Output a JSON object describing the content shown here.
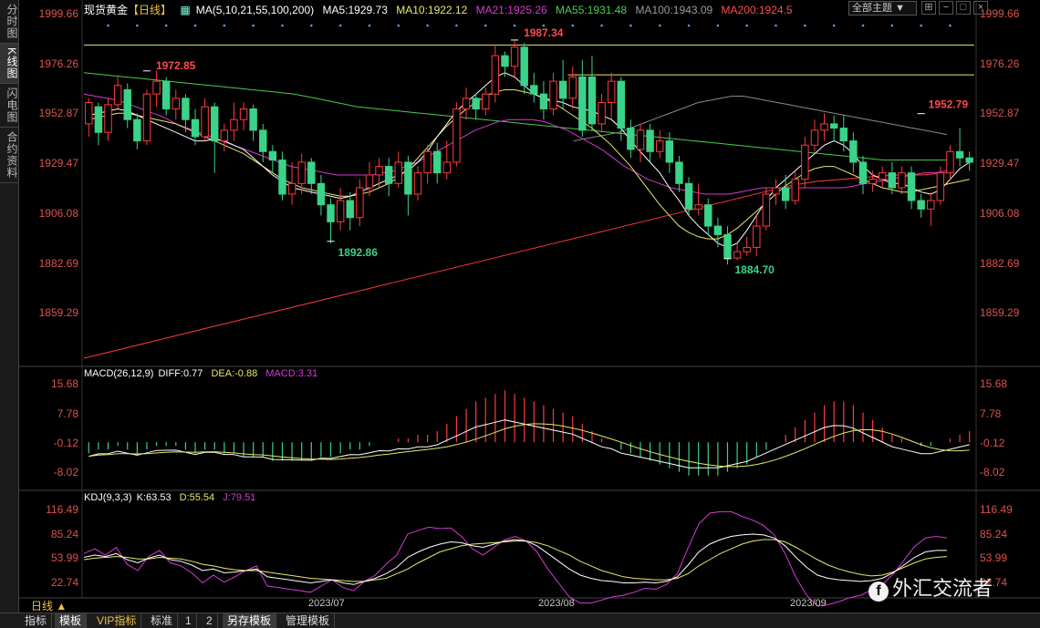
{
  "sidebar": {
    "items": [
      {
        "label": "分时图"
      },
      {
        "label": "K线图"
      },
      {
        "label": "闪电图"
      },
      {
        "label": "合约资料"
      }
    ]
  },
  "header": {
    "symbol": "现货黄金",
    "period": "【日线】",
    "ma_label": "MA(5,10,21,55,100,200)",
    "ma5": "MA5:1929.73",
    "ma10": "MA10:1922.12",
    "ma21": "MA21:1925.26",
    "ma55": "MA55:1931.48",
    "ma100": "MA100:1943.09",
    "ma200": "MA200:1924.5",
    "theme": "全部主题",
    "theme_arrow": "▼"
  },
  "colors": {
    "up": "#ff3b3b",
    "down": "#3ad389",
    "ma5": "#ffffff",
    "ma10": "#e8e86a",
    "ma21": "#d43bd4",
    "ma55": "#4ccb4c",
    "ma100": "#8a8a8a",
    "ma200": "#ff3b3b",
    "ref": "#e8e86a"
  },
  "price_axis": {
    "ticks": [
      "1999.66",
      "1976.26",
      "1952.87",
      "1929.47",
      "1906.08",
      "1882.69",
      "1859.29"
    ],
    "ymin": 1835,
    "ymax": 2001
  },
  "annotations": [
    {
      "text": "1972.85",
      "color": "#ff4b4b"
    },
    {
      "text": "1987.34",
      "color": "#ff4b4b"
    },
    {
      "text": "1892.86",
      "color": "#3ad389"
    },
    {
      "text": "1952.79",
      "color": "#ff4b4b"
    },
    {
      "text": "1884.70",
      "color": "#3ad389"
    }
  ],
  "macd": {
    "label": "MACD(26,12,9)",
    "diff": "DIFF:0.77",
    "dea": "DEA:-0.88",
    "macd": "MACD:3.31",
    "ticks": [
      "15.68",
      "7.78",
      "-0.12",
      "-8.02"
    ]
  },
  "kdj": {
    "label": "KDJ(9,3,3)",
    "k": "K:63.53",
    "d": "D:55.54",
    "j": "J:79.51",
    "ticks": [
      "116.49",
      "85.24",
      "53.99",
      "22.74"
    ]
  },
  "date_axis": {
    "labels": [
      "2023/07",
      "2023/08",
      "2023/09"
    ]
  },
  "period_label": "日线",
  "bottom_tabs": [
    "指标",
    "模板",
    "VIP指标",
    "标准",
    "1",
    "2",
    "另存模板",
    "管理模板"
  ],
  "watermark": {
    "logo": "f",
    "text": "外汇交流者"
  },
  "chart_data": {
    "type": "candlestick",
    "candles": [
      [
        1948,
        1958,
        1942,
        1960
      ],
      [
        1956,
        1944,
        1938,
        1958
      ],
      [
        1944,
        1957,
        1940,
        1960
      ],
      [
        1957,
        1966,
        1955,
        1970
      ],
      [
        1964,
        1950,
        1946,
        1967
      ],
      [
        1950,
        1940,
        1936,
        1953
      ],
      [
        1940,
        1962,
        1938,
        1964
      ],
      [
        1962,
        1968,
        1956,
        1973
      ],
      [
        1968,
        1955,
        1952,
        1970
      ],
      [
        1955,
        1960,
        1950,
        1964
      ],
      [
        1960,
        1950,
        1944,
        1962
      ],
      [
        1950,
        1942,
        1938,
        1955
      ],
      [
        1942,
        1956,
        1940,
        1960
      ],
      [
        1956,
        1940,
        1925,
        1958
      ],
      [
        1940,
        1945,
        1935,
        1948
      ],
      [
        1945,
        1950,
        1940,
        1958
      ],
      [
        1950,
        1955,
        1945,
        1958
      ],
      [
        1955,
        1945,
        1940,
        1957
      ],
      [
        1945,
        1935,
        1930,
        1948
      ],
      [
        1935,
        1931,
        1925,
        1938
      ],
      [
        1931,
        1915,
        1912,
        1935
      ],
      [
        1915,
        1920,
        1910,
        1930
      ],
      [
        1920,
        1930,
        1915,
        1934
      ],
      [
        1930,
        1920,
        1915,
        1932
      ],
      [
        1920,
        1910,
        1905,
        1924
      ],
      [
        1910,
        1902,
        1892,
        1913
      ],
      [
        1902,
        1912,
        1898,
        1918
      ],
      [
        1912,
        1904,
        1898,
        1916
      ],
      [
        1904,
        1918,
        1900,
        1922
      ],
      [
        1918,
        1924,
        1914,
        1930
      ],
      [
        1924,
        1928,
        1918,
        1932
      ],
      [
        1928,
        1920,
        1914,
        1932
      ],
      [
        1920,
        1930,
        1918,
        1935
      ],
      [
        1930,
        1915,
        1905,
        1933
      ],
      [
        1915,
        1925,
        1912,
        1928
      ],
      [
        1925,
        1935,
        1920,
        1938
      ],
      [
        1935,
        1925,
        1920,
        1939
      ],
      [
        1925,
        1930,
        1922,
        1940
      ],
      [
        1930,
        1955,
        1928,
        1958
      ],
      [
        1955,
        1960,
        1950,
        1965
      ],
      [
        1960,
        1955,
        1950,
        1962
      ],
      [
        1955,
        1962,
        1952,
        1965
      ],
      [
        1962,
        1980,
        1958,
        1985
      ],
      [
        1980,
        1975,
        1970,
        1982
      ],
      [
        1975,
        1984,
        1970,
        1987
      ],
      [
        1984,
        1966,
        1962,
        1986
      ],
      [
        1966,
        1962,
        1958,
        1972
      ],
      [
        1962,
        1955,
        1950,
        1968
      ],
      [
        1955,
        1968,
        1952,
        1972
      ],
      [
        1968,
        1960,
        1955,
        1978
      ],
      [
        1960,
        1970,
        1955,
        1975
      ],
      [
        1970,
        1945,
        1942,
        1978
      ],
      [
        1970,
        1948,
        1945,
        1980
      ],
      [
        1948,
        1958,
        1944,
        1962
      ],
      [
        1958,
        1968,
        1950,
        1972
      ],
      [
        1968,
        1946,
        1940,
        1970
      ],
      [
        1946,
        1936,
        1932,
        1950
      ],
      [
        1936,
        1945,
        1930,
        1948
      ],
      [
        1945,
        1935,
        1930,
        1948
      ],
      [
        1935,
        1940,
        1932,
        1945
      ],
      [
        1940,
        1930,
        1925,
        1944
      ],
      [
        1930,
        1920,
        1916,
        1933
      ],
      [
        1920,
        1908,
        1905,
        1923
      ],
      [
        1908,
        1910,
        1905,
        1920
      ],
      [
        1910,
        1900,
        1896,
        1913
      ],
      [
        1900,
        1896,
        1890,
        1904
      ],
      [
        1896,
        1885,
        1882,
        1900
      ],
      [
        1885,
        1888,
        1884,
        1892
      ],
      [
        1888,
        1890,
        1886,
        1895
      ],
      [
        1890,
        1900,
        1886,
        1905
      ],
      [
        1900,
        1915,
        1898,
        1918
      ],
      [
        1915,
        1918,
        1910,
        1922
      ],
      [
        1918,
        1912,
        1908,
        1924
      ],
      [
        1912,
        1922,
        1910,
        1926
      ],
      [
        1922,
        1938,
        1918,
        1942
      ],
      [
        1938,
        1945,
        1935,
        1950
      ],
      [
        1945,
        1948,
        1940,
        1953
      ],
      [
        1948,
        1946,
        1940,
        1952
      ],
      [
        1946,
        1940,
        1935,
        1952
      ],
      [
        1940,
        1930,
        1925,
        1944
      ],
      [
        1930,
        1920,
        1915,
        1933
      ],
      [
        1920,
        1922,
        1916,
        1926
      ],
      [
        1922,
        1925,
        1918,
        1928
      ],
      [
        1925,
        1918,
        1915,
        1930
      ],
      [
        1918,
        1925,
        1915,
        1928
      ],
      [
        1925,
        1912,
        1908,
        1928
      ],
      [
        1912,
        1908,
        1904,
        1915
      ],
      [
        1908,
        1912,
        1900,
        1916
      ],
      [
        1912,
        1925,
        1910,
        1928
      ],
      [
        1925,
        1935,
        1922,
        1938
      ],
      [
        1935,
        1932,
        1928,
        1946
      ],
      [
        1932,
        1930,
        1926,
        1935
      ]
    ],
    "ma_lines": {
      "ma5": [
        1952,
        1953,
        1954,
        1955,
        1954,
        1952,
        1950,
        1948,
        1946,
        1944,
        1942,
        1940,
        1940,
        1941,
        1940,
        1938,
        1936,
        1932,
        1928,
        1924,
        1921,
        1918,
        1917,
        1916,
        1915,
        1914,
        1913,
        1914,
        1916,
        1918,
        1920,
        1922,
        1924,
        1926,
        1930,
        1935,
        1942,
        1948,
        1954,
        1958,
        1962,
        1966,
        1970,
        1972,
        1970,
        1966,
        1962,
        1960,
        1959,
        1958,
        1956,
        1955,
        1954,
        1952,
        1950,
        1946,
        1940,
        1935,
        1930,
        1925,
        1918,
        1912,
        1905,
        1900,
        1896,
        1892,
        1890,
        1892,
        1898,
        1905,
        1912,
        1918,
        1922,
        1926,
        1930,
        1934,
        1938,
        1940,
        1938,
        1934,
        1928,
        1924,
        1922,
        1920,
        1920,
        1918,
        1916,
        1915,
        1917,
        1922,
        1927,
        1930
      ],
      "ma10": [
        1950,
        1951,
        1952,
        1953,
        1953,
        1952,
        1951,
        1950,
        1949,
        1948,
        1946,
        1944,
        1942,
        1940,
        1938,
        1936,
        1934,
        1931,
        1928,
        1925,
        1922,
        1920,
        1918,
        1917,
        1916,
        1915,
        1914,
        1914,
        1915,
        1916,
        1918,
        1920,
        1923,
        1927,
        1932,
        1937,
        1942,
        1947,
        1951,
        1955,
        1958,
        1961,
        1963,
        1964,
        1964,
        1963,
        1962,
        1960,
        1958,
        1955,
        1952,
        1949,
        1946,
        1942,
        1938,
        1933,
        1928,
        1922,
        1916,
        1910,
        1905,
        1900,
        1897,
        1895,
        1894,
        1894,
        1896,
        1899,
        1903,
        1907,
        1911,
        1915,
        1919,
        1922,
        1925,
        1927,
        1928,
        1928,
        1926,
        1924,
        1922,
        1920,
        1918,
        1917,
        1916,
        1916,
        1917,
        1918,
        1919,
        1920,
        1921,
        1922
      ],
      "ma21": [
        1962,
        1961,
        1960,
        1959,
        1957,
        1955,
        1953,
        1951,
        1948,
        1946,
        1944,
        1942,
        1940,
        1938,
        1936,
        1934,
        1932,
        1930,
        1928,
        1927,
        1926,
        1925,
        1924,
        1924,
        1924,
        1924,
        1925,
        1926,
        1928,
        1930,
        1933,
        1936,
        1939,
        1942,
        1945,
        1947,
        1949,
        1950,
        1950,
        1950,
        1949,
        1947,
        1945,
        1942,
        1939,
        1936,
        1932,
        1928,
        1925,
        1922,
        1920,
        1918,
        1917,
        1916,
        1915,
        1915,
        1915,
        1916,
        1917,
        1918,
        1918,
        1918,
        1918,
        1918,
        1918,
        1918,
        1918,
        1919,
        1920,
        1921,
        1922,
        1923,
        1924,
        1925,
        1925,
        1926
      ],
      "ma55": [
        1972,
        1971,
        1970,
        1969,
        1968,
        1967,
        1966,
        1965,
        1964,
        1963,
        1962,
        1960,
        1958,
        1956,
        1955,
        1954,
        1953,
        1952,
        1951,
        1950,
        1949,
        1948,
        1947,
        1946,
        1945,
        1944,
        1943,
        1942,
        1941,
        1940,
        1939,
        1938,
        1937,
        1936,
        1935,
        1934,
        1933,
        1932,
        1931,
        1931,
        1931,
        1931
      ],
      "ma100": [
        1940,
        1941,
        1942,
        1943,
        1944,
        1946,
        1948,
        1950,
        1952,
        1954,
        1956,
        1958,
        1959,
        1960,
        1961,
        1961,
        1960,
        1959,
        1958,
        1957,
        1956,
        1955,
        1954,
        1953,
        1952,
        1951,
        1950,
        1949,
        1948,
        1947,
        1946,
        1945,
        1944,
        1943
      ],
      "ma200": [
        1838,
        1841,
        1844,
        1847,
        1850,
        1853,
        1856,
        1859,
        1862,
        1865,
        1868,
        1871,
        1874,
        1877,
        1880,
        1883,
        1886,
        1889,
        1892,
        1895,
        1898,
        1901,
        1904,
        1907,
        1910,
        1913,
        1916,
        1919,
        1921,
        1922,
        1923,
        1924,
        1924,
        1925
      ]
    },
    "ref_lines": [
      1985,
      1971
    ],
    "macd_hist": [
      -3,
      -2,
      -2,
      -1,
      -2,
      -3,
      -2,
      -1,
      -1,
      -1,
      -2,
      -3,
      -2,
      -2,
      -3,
      -3,
      -4,
      -4,
      -4,
      -5,
      -5,
      -5,
      -5,
      -5,
      -4,
      -4,
      -3,
      -2,
      -2,
      -1,
      0,
      0,
      1,
      1,
      2,
      2,
      3,
      5,
      7,
      9,
      11,
      12,
      13,
      14,
      13,
      12,
      11,
      10,
      9,
      8,
      7,
      5,
      3,
      1,
      0,
      -2,
      -3,
      -4,
      -5,
      -6,
      -7,
      -8,
      -9,
      -9,
      -9,
      -9,
      -8,
      -7,
      -6,
      -4,
      -2,
      0,
      2,
      4,
      6,
      8,
      10,
      11,
      11,
      10,
      8,
      6,
      4,
      2,
      1,
      0,
      -1,
      -1,
      0,
      1,
      2,
      3
    ],
    "kdj_k": [
      55,
      58,
      56,
      60,
      52,
      48,
      54,
      58,
      52,
      50,
      45,
      38,
      40,
      35,
      36,
      38,
      40,
      30,
      28,
      26,
      24,
      22,
      24,
      26,
      22,
      20,
      24,
      28,
      34,
      42,
      55,
      62,
      68,
      72,
      75,
      74,
      70,
      68,
      72,
      76,
      78,
      76,
      70,
      60,
      50,
      40,
      32,
      28,
      25,
      24,
      22,
      22,
      23,
      22,
      24,
      30,
      45,
      62,
      72,
      78,
      82,
      84,
      85,
      84,
      80,
      70,
      55,
      42,
      32,
      28,
      26,
      25,
      24,
      25,
      28,
      35,
      45,
      55,
      62,
      64,
      64
    ],
    "kdj_d": [
      52,
      54,
      55,
      56,
      55,
      53,
      53,
      55,
      54,
      53,
      50,
      46,
      44,
      41,
      39,
      38,
      38,
      36,
      34,
      32,
      30,
      28,
      27,
      26,
      25,
      24,
      24,
      26,
      28,
      34,
      40,
      48,
      55,
      62,
      66,
      70,
      72,
      73,
      74,
      75,
      76,
      76,
      74,
      70,
      64,
      58,
      50,
      44,
      38,
      34,
      30,
      28,
      27,
      26,
      26,
      28,
      34,
      44,
      52,
      60,
      66,
      72,
      76,
      78,
      78,
      75,
      68,
      60,
      52,
      45,
      40,
      36,
      33,
      31,
      32,
      36,
      42,
      48,
      53,
      55,
      56
    ],
    "kdj_j": [
      60,
      66,
      58,
      68,
      46,
      38,
      56,
      64,
      48,
      44,
      35,
      22,
      32,
      23,
      30,
      38,
      44,
      18,
      16,
      14,
      12,
      10,
      18,
      26,
      16,
      12,
      24,
      32,
      46,
      58,
      85,
      90,
      94,
      92,
      93,
      82,
      66,
      58,
      68,
      78,
      82,
      76,
      62,
      40,
      22,
      4,
      -4,
      -4,
      0,
      4,
      6,
      10,
      15,
      14,
      20,
      34,
      67,
      98,
      112,
      114,
      114,
      108,
      103,
      96,
      84,
      60,
      29,
      6,
      -8,
      -6,
      -2,
      3,
      6,
      13,
      20,
      33,
      51,
      69,
      80,
      82,
      80
    ]
  }
}
